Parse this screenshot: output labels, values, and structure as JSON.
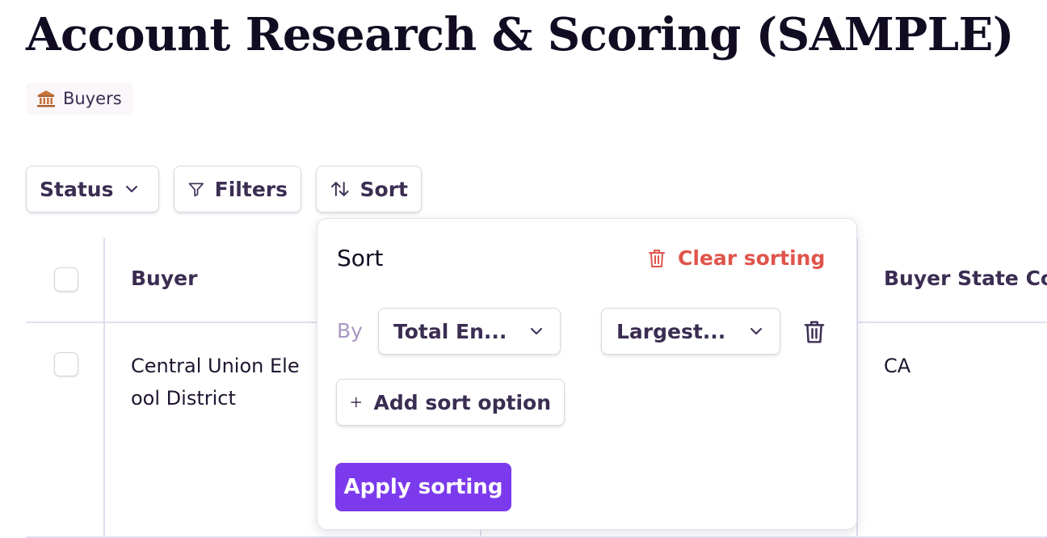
{
  "page": {
    "title": "Account Research & Scoring (SAMPLE)",
    "tag": {
      "icon": "bank-icon",
      "label": "Buyers"
    }
  },
  "toolbar": {
    "status_label": "Status",
    "filters_label": "Filters",
    "sort_label": "Sort"
  },
  "table": {
    "columns": [
      "Buyer",
      "Buyer State Co"
    ],
    "rows": [
      {
        "buyer_line1": "Central Union Ele",
        "buyer_line2": "ool District",
        "state": "CA"
      }
    ]
  },
  "sort_popover": {
    "title": "Sort",
    "clear_label": "Clear sorting",
    "by_label": "By",
    "field_value": "Total En...",
    "order_value": "Largest...",
    "add_label": "Add sort option",
    "apply_label": "Apply sorting"
  },
  "colors": {
    "accent": "#7c3aed",
    "danger": "#e0544b",
    "text": "#3b2d52"
  }
}
